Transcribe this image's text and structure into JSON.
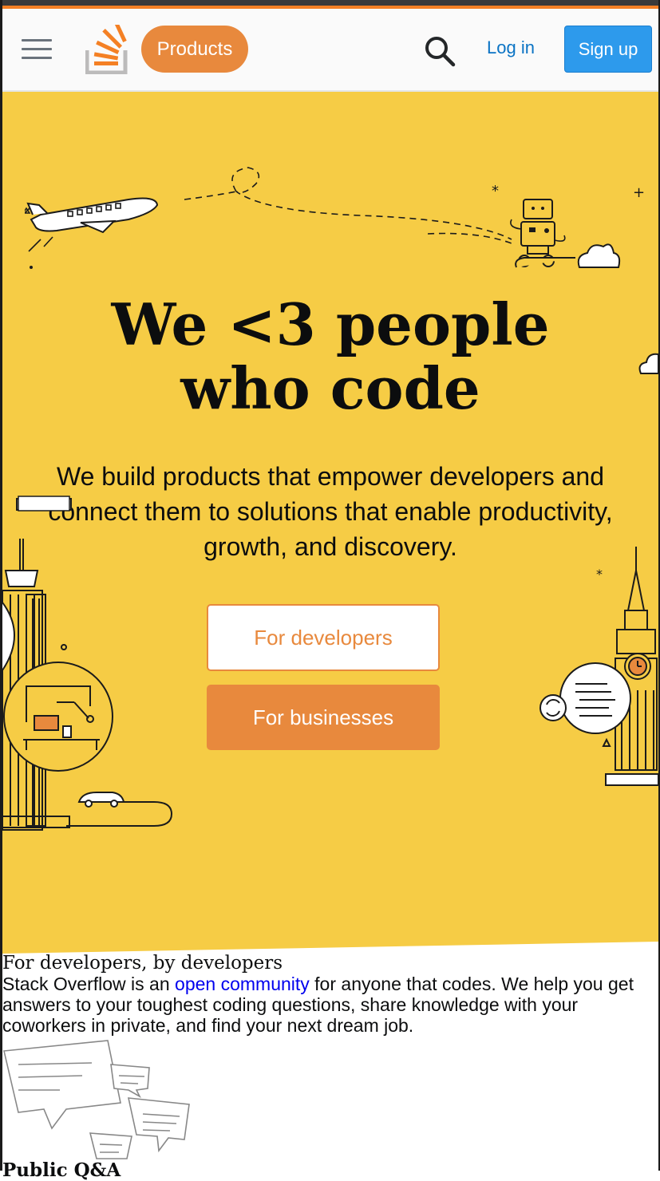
{
  "header": {
    "products_label": "Products",
    "login_label": "Log in",
    "signup_label": "Sign up"
  },
  "hero": {
    "title": "We <3 people who code",
    "subtitle": "We build products that empower developers and connect them to solutions that enable productivity, growth, and discovery.",
    "for_developers_label": "For developers",
    "for_businesses_label": "For businesses"
  },
  "developers_section": {
    "heading": "For developers, by developers",
    "text_before": "Stack Overflow is an ",
    "link_text": "open community",
    "text_after": " for anyone that codes. We help you get answers to your toughest coding questions, share knowledge with your coworkers in private, and find your next dream job.",
    "next_heading": "Public Q&A"
  },
  "colors": {
    "brand_orange": "#f48024",
    "button_orange": "#e8893d",
    "hero_yellow": "#f6cc45",
    "signup_blue": "#2d9aec",
    "link_blue": "#0a73c4"
  },
  "icons": [
    "hamburger-menu-icon",
    "stack-overflow-logo",
    "search-icon"
  ]
}
